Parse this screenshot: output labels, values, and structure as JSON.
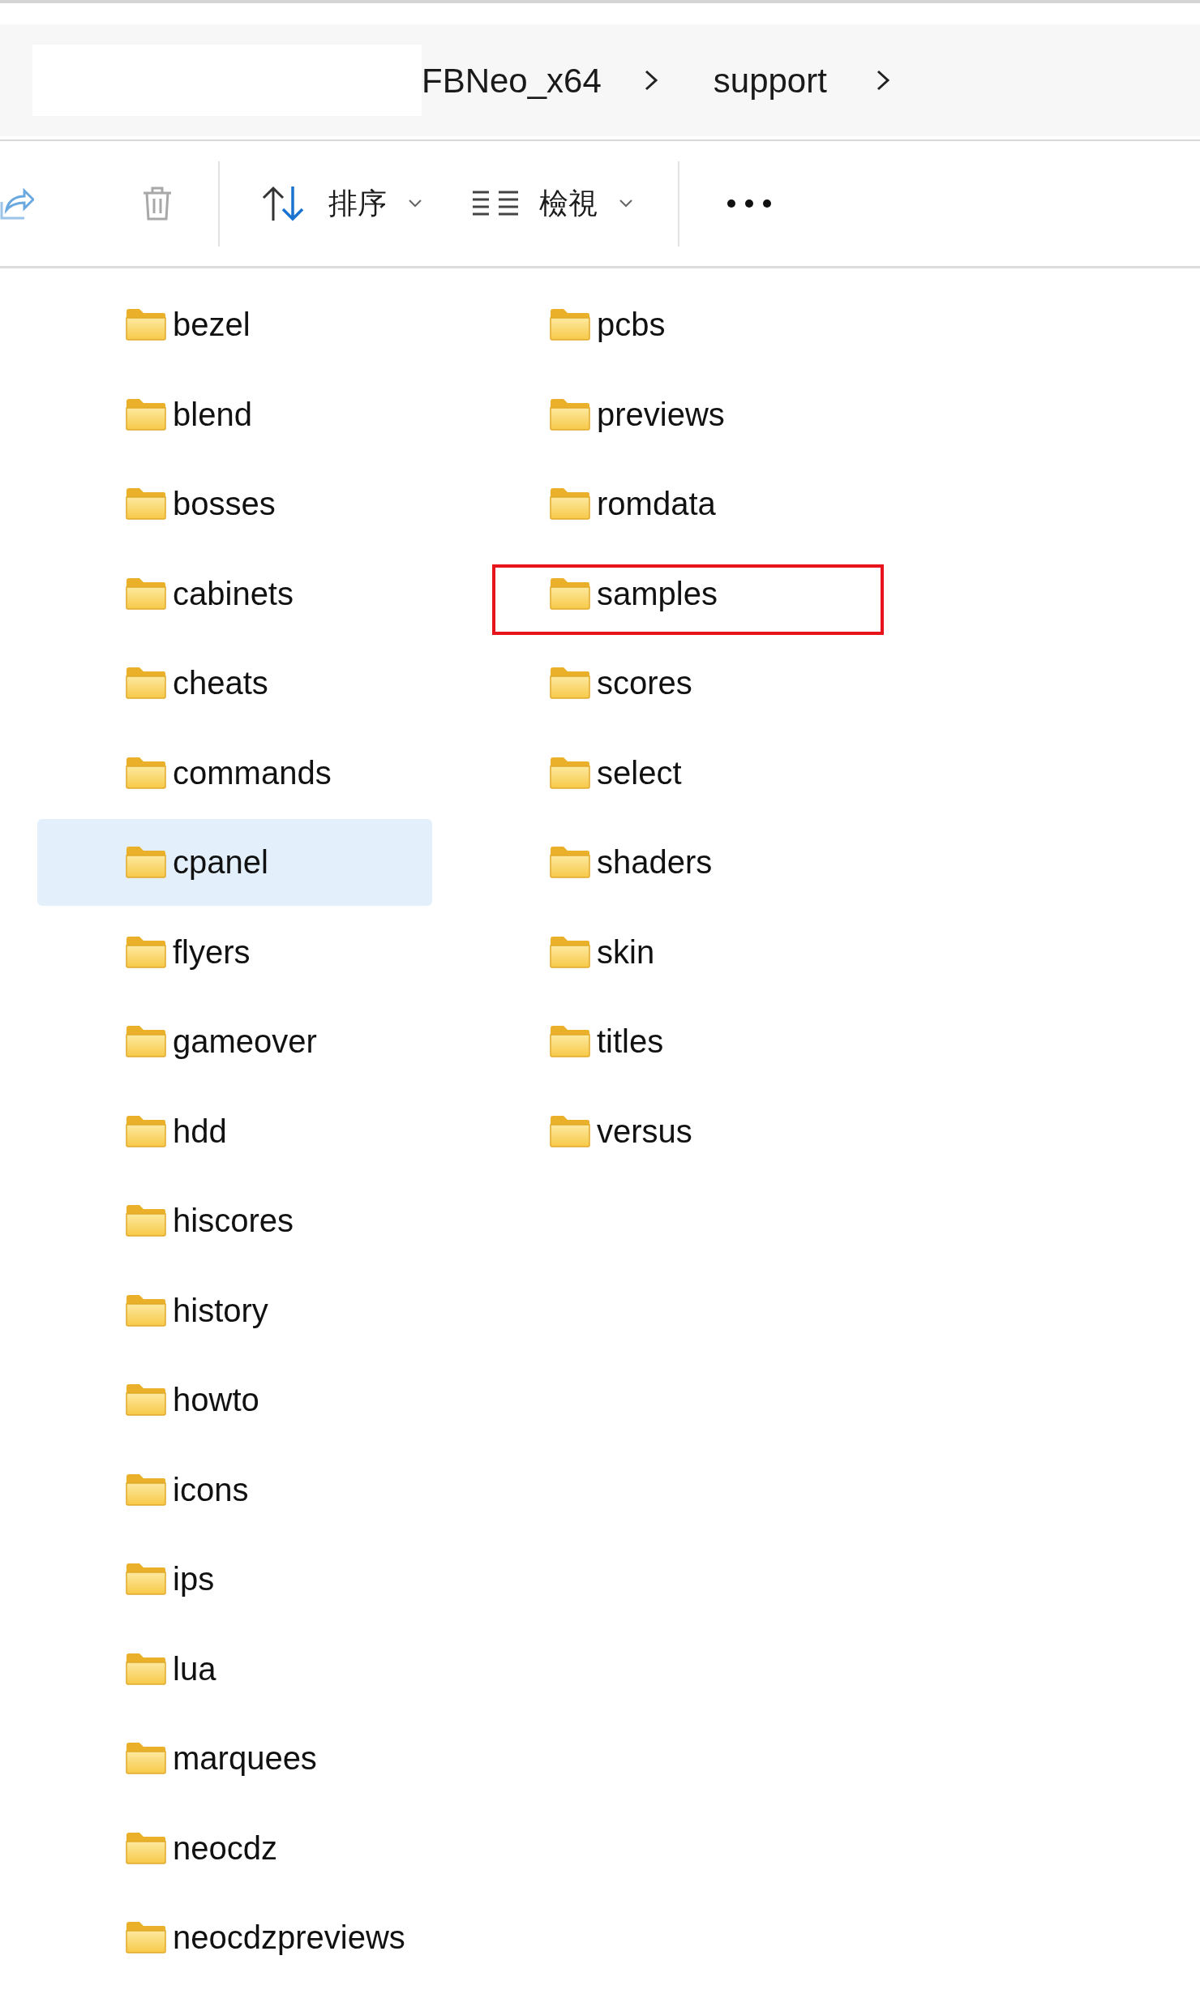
{
  "breadcrumb": [
    {
      "label": "FBNeo_x64"
    },
    {
      "label": "support"
    }
  ],
  "toolbar": {
    "sort": "排序",
    "view": "檢視"
  },
  "items": [
    {
      "name": "bezel",
      "selected": false,
      "highlighted": false
    },
    {
      "name": "blend",
      "selected": false,
      "highlighted": false
    },
    {
      "name": "bosses",
      "selected": false,
      "highlighted": false
    },
    {
      "name": "cabinets",
      "selected": false,
      "highlighted": false
    },
    {
      "name": "cheats",
      "selected": false,
      "highlighted": false
    },
    {
      "name": "commands",
      "selected": false,
      "highlighted": false
    },
    {
      "name": "cpanel",
      "selected": true,
      "highlighted": false
    },
    {
      "name": "flyers",
      "selected": false,
      "highlighted": false
    },
    {
      "name": "gameover",
      "selected": false,
      "highlighted": false
    },
    {
      "name": "hdd",
      "selected": false,
      "highlighted": false
    },
    {
      "name": "hiscores",
      "selected": false,
      "highlighted": false
    },
    {
      "name": "history",
      "selected": false,
      "highlighted": false
    },
    {
      "name": "howto",
      "selected": false,
      "highlighted": false
    },
    {
      "name": "icons",
      "selected": false,
      "highlighted": false
    },
    {
      "name": "ips",
      "selected": false,
      "highlighted": false
    },
    {
      "name": "lua",
      "selected": false,
      "highlighted": false
    },
    {
      "name": "marquees",
      "selected": false,
      "highlighted": false
    },
    {
      "name": "neocdz",
      "selected": false,
      "highlighted": false
    },
    {
      "name": "neocdzpreviews",
      "selected": false,
      "highlighted": false
    },
    {
      "name": "pcbs",
      "selected": false,
      "highlighted": false
    },
    {
      "name": "previews",
      "selected": false,
      "highlighted": false
    },
    {
      "name": "romdata",
      "selected": false,
      "highlighted": false
    },
    {
      "name": "samples",
      "selected": false,
      "highlighted": true
    },
    {
      "name": "scores",
      "selected": false,
      "highlighted": false
    },
    {
      "name": "select",
      "selected": false,
      "highlighted": false
    },
    {
      "name": "shaders",
      "selected": false,
      "highlighted": false
    },
    {
      "name": "skin",
      "selected": false,
      "highlighted": false
    },
    {
      "name": "titles",
      "selected": false,
      "highlighted": false
    },
    {
      "name": "versus",
      "selected": false,
      "highlighted": false
    }
  ]
}
